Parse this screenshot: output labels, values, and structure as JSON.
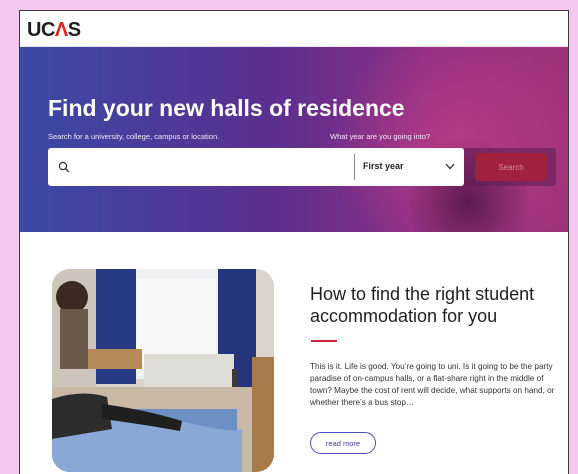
{
  "header": {
    "logo_left": "UC",
    "logo_accent": "Λ",
    "logo_right": "S"
  },
  "hero": {
    "title": "Find your new halls of residence",
    "search_label": "Search for a university, college, campus or location.",
    "year_label": "What year are you going into?",
    "search_placeholder": "",
    "year_selected": "First year",
    "search_button": "Search"
  },
  "article": {
    "title": "How to find the right student accommodation for you",
    "body": "This is it. Life is good. You’re going to uni. Is it going to be the party paradise of on-campus halls, or a flat-share right in the middle of town? Maybe the cost of rent will decide, what supports on hand, or whether there’s a bus stop…",
    "read_more": "read more"
  },
  "colors": {
    "accent_red": "#d0263c",
    "button_dark_red": "#a2213f",
    "link_blue": "#4a4fb8",
    "page_background": "#f4c8f0"
  },
  "icons": [
    "search-icon",
    "chevron-down-icon"
  ]
}
